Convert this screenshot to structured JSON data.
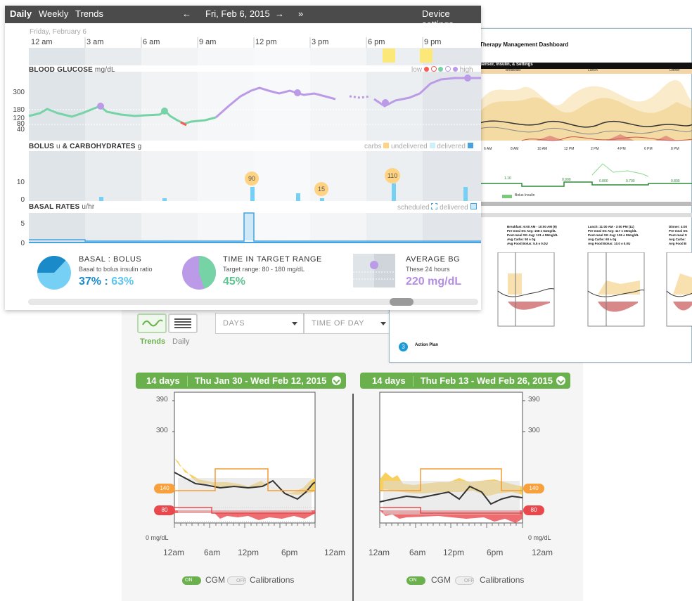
{
  "daily_view": {
    "nav": {
      "daily": "Daily",
      "weekly": "Weekly",
      "trends": "Trends",
      "prev_arrow": "←",
      "date": "Fri, Feb 6, 2015",
      "next_arrow": "→",
      "last_arrow": "»",
      "device_settings": "Device settings"
    },
    "day_label": "Friday, February 6",
    "time_ticks": [
      "12 am",
      "3 am",
      "6 am",
      "9 am",
      "12 pm",
      "3 pm",
      "6 pm",
      "9 pm"
    ],
    "blood_glucose": {
      "title": "BLOOD GLUCOSE",
      "unit": "mg/dL",
      "y_ticks": [
        "300",
        "180",
        "120",
        "80",
        "40"
      ],
      "legend_low": "low",
      "legend_high": "high"
    },
    "bolus": {
      "title": "BOLUS",
      "unit_u": "u",
      "and_carbs": "& CARBOHYDRATES",
      "unit_g": "g",
      "legend_carbs": "carbs",
      "legend_undelivered": "undelivered",
      "legend_delivered": "delivered",
      "y_ticks": [
        "10",
        "0"
      ],
      "carb_values": [
        "90",
        "15",
        "110"
      ]
    },
    "basal": {
      "title": "BASAL RATES",
      "unit": "u/hr",
      "legend_scheduled": "scheduled",
      "legend_delivered": "delivered",
      "y_ticks": [
        "5",
        "0"
      ]
    },
    "stats": {
      "basal_bolus": {
        "title": "BASAL : BOLUS",
        "subtitle": "Basal to bolus insulin ratio",
        "basal_pct": "37%",
        "colon": " : ",
        "bolus_pct": "63%",
        "basal_fraction": 0.37
      },
      "target_range": {
        "title": "TIME IN TARGET RANGE",
        "subtitle": "Target range: 80 - 180 mg/dL",
        "value": "45%",
        "fraction": 0.45
      },
      "average_bg": {
        "title": "AVERAGE BG",
        "subtitle": "These 24 hours",
        "value": "220 mg/dL"
      }
    },
    "colors": {
      "target": "#76d3a6",
      "high": "#bb9ae7",
      "low": "#fb5951",
      "bolus": "#76d0f5",
      "carbs": "#ffd382",
      "basal": "#46a3e0",
      "topbar": "#4b4b4b"
    }
  },
  "dashboard": {
    "title": "Therapy Management Dashboard",
    "section_header": "Sensor, Insulin, & Settings",
    "meal_tabs": [
      "Breakfast",
      "Lunch",
      "Dinner"
    ],
    "time_axis": [
      "6 AM",
      "8 AM",
      "10 AM",
      "12 PM",
      "2 PM",
      "4 PM",
      "6 PM",
      "8 PM"
    ],
    "basal_values": [
      "1.10",
      "0.900",
      "0.800",
      "0.700",
      "0.800"
    ],
    "bolus_legend": "Bolus Insulin",
    "meal_summaries": [
      {
        "heading": "Breakfast: 6:00 AM - 10:00 AM (9)",
        "lines": [
          "Pre-meal SG Avg: 158 ± 64mg/dL",
          "Post-meal SG Avg: 121 ± 59mg/dL",
          "Avg Carbs: 50 ± 0g",
          "Avg Food Bolus: 5.5 ± 0.0U"
        ]
      },
      {
        "heading": "Lunch: 11:00 AM - 3:00 PM (11)",
        "lines": [
          "Pre-meal SG Avg: 117 ± 35mg/dL",
          "Post-meal SG Avg: 126 ± 55mg/dL",
          "Avg Carbs: 60 ± 0g",
          "Avg Food Bolus: 10.0 ± 0.0U"
        ]
      },
      {
        "heading": "Dinner: 4:00",
        "lines": [
          "Pre-meal SG",
          "Post-meal S",
          "Avg Carbs:",
          "Avg Food B"
        ]
      }
    ],
    "action_plan_num": "3",
    "action_plan": "Action Plan"
  },
  "trends_view": {
    "toggle_trends": "Trends",
    "toggle_daily": "Daily",
    "dropdown_days": "DAYS",
    "dropdown_time": "TIME OF DAY",
    "periods": [
      {
        "days": "14 days",
        "range": "Thu Jan 30 - Wed Feb 12, 2015"
      },
      {
        "days": "14 days",
        "range": "Thu Feb 13 - Wed Feb 26, 2015"
      }
    ],
    "y_labels": [
      "390",
      "300",
      "0 mg/dL"
    ],
    "target_high": "140",
    "target_low": "80",
    "x_labels": [
      "12am",
      "6am",
      "12pm",
      "6pm",
      "12am"
    ],
    "cgm_toggle_on": "ON",
    "cgm_label": "CGM",
    "cal_toggle_off": "OFF",
    "cal_label": "Calibrations"
  }
}
